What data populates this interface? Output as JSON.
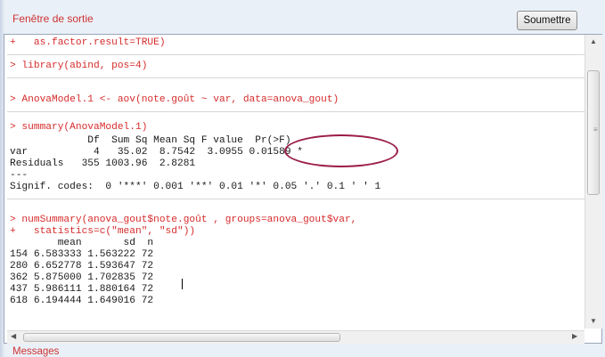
{
  "window": {
    "output_title": "Fenêtre de sortie",
    "submit_label": "Soumettre",
    "messages_label": "Messages"
  },
  "console_lines": [
    "+   as.factor.result=TRUE)",
    "> library(abind, pos=4)",
    "> AnovaModel.1 <- aov(note.goût ~ var, data=anova_gout)",
    "> summary(AnovaModel.1)",
    "             Df  Sum Sq Mean Sq F value  Pr(>F)  ",
    "var           4   35.02  8.7542  3.0955 0.01589 *",
    "Residuals   355 1003.96  2.8281",
    "---",
    "Signif. codes:  0 '***' 0.001 '**' 0.01 '*' 0.05 '.' 0.1 ' ' 1",
    "> numSummary(anova_gout$note.goût , groups=anova_gout$var,",
    "+   statistics=c(\"mean\", \"sd\"))",
    "        mean       sd  n",
    "154 6.583333 1.563222 72",
    "280 6.652778 1.593647 72",
    "362 5.875000 1.702835 72",
    "437 5.986111 1.880164 72",
    "618 6.194444 1.649016 72"
  ],
  "icons": {
    "scroll_up": "triangle-up",
    "scroll_down": "triangle-down",
    "scroll_left": "triangle-left",
    "scroll_right": "triangle-right",
    "grip": "grip-lines"
  },
  "colors": {
    "command": "#d62b2b",
    "output": "#1a1a1a",
    "highlight_ellipse": "#9b1c4a",
    "title": "#cc3333"
  }
}
